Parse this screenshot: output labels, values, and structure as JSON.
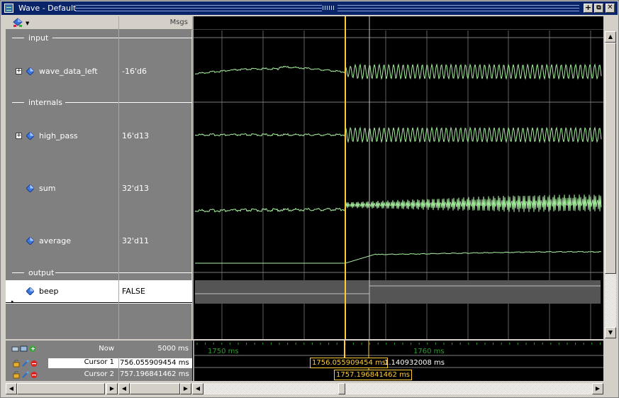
{
  "window": {
    "title": "Wave - Default"
  },
  "title_buttons": [
    "+",
    "⧉",
    "✕"
  ],
  "columns": {
    "values_header": "Msgs"
  },
  "signals": [
    {
      "type": "group",
      "label": "input"
    },
    {
      "type": "signal",
      "name": "wave_data_left",
      "value": "-16'd6",
      "expandable": true,
      "icon": "diamond-icon"
    },
    {
      "type": "group",
      "label": "internals"
    },
    {
      "type": "signal",
      "name": "high_pass",
      "value": "16'd13",
      "expandable": true,
      "icon": "diamond-icon"
    },
    {
      "type": "signal",
      "name": "sum",
      "value": "32'd13",
      "expandable": false,
      "icon": "diamond-icon"
    },
    {
      "type": "signal",
      "name": "average",
      "value": "32'd11",
      "expandable": false,
      "icon": "diamond-icon"
    },
    {
      "type": "group",
      "label": "output"
    },
    {
      "type": "signal",
      "name": "beep",
      "value": "FALSE",
      "expandable": false,
      "icon": "diamond-icon",
      "selected": true
    }
  ],
  "cursors": {
    "now_label": "Now",
    "now_value": "5000 ms",
    "cursor1_label": "Cursor 1",
    "cursor1_value": "756.055909454 ms",
    "cursor2_label": "Cursor 2",
    "cursor2_value": "757.196841462 ms",
    "cursor1_marker": "1756.055909454 ms",
    "cursor2_marker": "1757.196841462 ms",
    "delta": "1.140932008 ms"
  },
  "timeline": {
    "labels": [
      "1750 ms",
      "1760 ms"
    ]
  },
  "colors": {
    "wave": "#a8f0a0",
    "cursor": "#ffcc33",
    "grid": "#606060",
    "timeline_label": "#2e9b2e",
    "selected_row": "#ffffff",
    "titlebar": "#0a246a"
  }
}
